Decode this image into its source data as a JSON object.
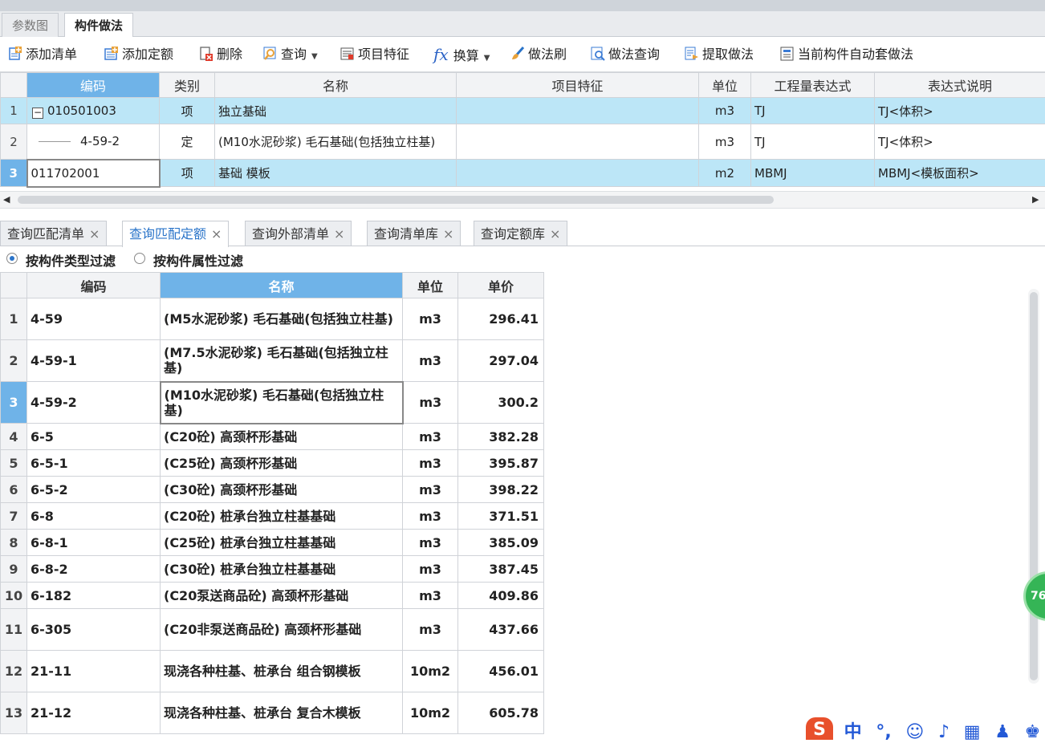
{
  "main_tabs": [
    {
      "label": "参数图",
      "active": false
    },
    {
      "label": "构件做法",
      "active": true
    }
  ],
  "toolbar": [
    {
      "label": "添加清单",
      "icon": "add-list-icon"
    },
    {
      "label": "添加定额",
      "icon": "add-quota-icon"
    },
    {
      "label": "删除",
      "icon": "delete-icon"
    },
    {
      "label": "查询",
      "icon": "search-icon",
      "dropdown": true
    },
    {
      "label": "项目特征",
      "icon": "feature-icon"
    },
    {
      "label": "换算",
      "icon": "fx-icon",
      "dropdown": true
    },
    {
      "label": "做法刷",
      "icon": "brush-icon"
    },
    {
      "label": "做法查询",
      "icon": "method-search-icon"
    },
    {
      "label": "提取做法",
      "icon": "extract-icon"
    },
    {
      "label": "当前构件自动套做法",
      "icon": "auto-apply-icon"
    }
  ],
  "top_table": {
    "headers": [
      "编码",
      "类别",
      "名称",
      "项目特征",
      "单位",
      "工程量表达式",
      "表达式说明"
    ],
    "rows": [
      {
        "num": "1",
        "code": "010501003",
        "type": "项",
        "name": "独立基础",
        "feature": "",
        "unit": "m3",
        "expr": "TJ",
        "desc": "TJ<体积>",
        "highlight": true,
        "collapse": "−"
      },
      {
        "num": "2",
        "code": "4-59-2",
        "type": "定",
        "name": "(M10水泥砂浆) 毛石基础(包括独立柱基)",
        "feature": "",
        "unit": "m3",
        "expr": "TJ",
        "desc": "TJ<体积>",
        "highlight": false
      },
      {
        "num": "3",
        "code": "011702001",
        "type": "项",
        "name": "基础 模板",
        "feature": "",
        "unit": "m2",
        "expr": "MBMJ",
        "desc": "MBMJ<模板面积>",
        "highlight": true,
        "selected": true
      }
    ]
  },
  "query_tabs": [
    {
      "label": "查询匹配清单",
      "active": false
    },
    {
      "label": "查询匹配定额",
      "active": true
    },
    {
      "label": "查询外部清单",
      "active": false
    },
    {
      "label": "查询清单库",
      "active": false
    },
    {
      "label": "查询定额库",
      "active": false
    }
  ],
  "close_glyph": "×",
  "filters": [
    {
      "label": "按构件类型过滤",
      "checked": true
    },
    {
      "label": "按构件属性过滤",
      "checked": false
    }
  ],
  "bottom_table": {
    "headers": [
      "编码",
      "名称",
      "单位",
      "单价"
    ],
    "rows": [
      {
        "num": "1",
        "code": "4-59",
        "name": "(M5水泥砂浆) 毛石基础(包括独立柱基)",
        "unit": "m3",
        "price": "296.41"
      },
      {
        "num": "2",
        "code": "4-59-1",
        "name": "(M7.5水泥砂浆) 毛石基础(包括独立柱基)",
        "unit": "m3",
        "price": "297.04"
      },
      {
        "num": "3",
        "code": "4-59-2",
        "name": "(M10水泥砂浆) 毛石基础(包括独立柱基)",
        "unit": "m3",
        "price": "300.2",
        "selected": true
      },
      {
        "num": "4",
        "code": "6-5",
        "name": "(C20砼) 高颈杯形基础",
        "unit": "m3",
        "price": "382.28"
      },
      {
        "num": "5",
        "code": "6-5-1",
        "name": "(C25砼) 高颈杯形基础",
        "unit": "m3",
        "price": "395.87"
      },
      {
        "num": "6",
        "code": "6-5-2",
        "name": "(C30砼) 高颈杯形基础",
        "unit": "m3",
        "price": "398.22"
      },
      {
        "num": "7",
        "code": "6-8",
        "name": "(C20砼) 桩承台独立柱基基础",
        "unit": "m3",
        "price": "371.51"
      },
      {
        "num": "8",
        "code": "6-8-1",
        "name": "(C25砼) 桩承台独立柱基基础",
        "unit": "m3",
        "price": "385.09"
      },
      {
        "num": "9",
        "code": "6-8-2",
        "name": "(C30砼) 桩承台独立柱基基础",
        "unit": "m3",
        "price": "387.45"
      },
      {
        "num": "10",
        "code": "6-182",
        "name": "(C20泵送商品砼) 高颈杯形基础",
        "unit": "m3",
        "price": "409.86"
      },
      {
        "num": "11",
        "code": "6-305",
        "name": "(C20非泵送商品砼) 高颈杯形基础",
        "unit": "m3",
        "price": "437.66"
      },
      {
        "num": "12",
        "code": "21-11",
        "name": "现浇各种柱基、桩承台 组合钢模板",
        "unit": "10m2",
        "price": "456.01"
      },
      {
        "num": "13",
        "code": "21-12",
        "name": "现浇各种柱基、桩承台 复合木模板",
        "unit": "10m2",
        "price": "605.78"
      }
    ]
  },
  "badge": {
    "text": "76"
  },
  "ime": {
    "logo": "S",
    "mode": "中",
    "items": [
      "°,",
      "☺",
      "♪",
      "▦",
      "♟",
      "♚",
      "⊞"
    ]
  }
}
